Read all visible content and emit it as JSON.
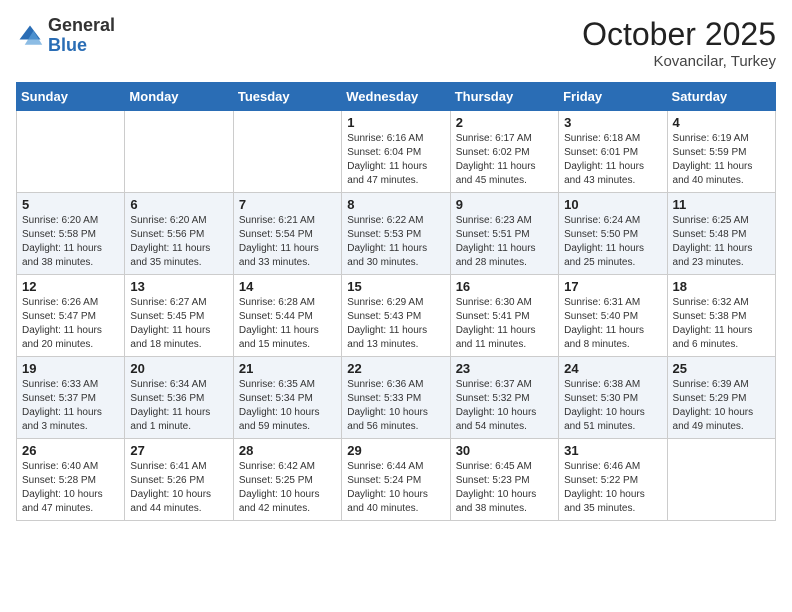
{
  "header": {
    "logo_general": "General",
    "logo_blue": "Blue",
    "month_title": "October 2025",
    "subtitle": "Kovancilar, Turkey"
  },
  "days_of_week": [
    "Sunday",
    "Monday",
    "Tuesday",
    "Wednesday",
    "Thursday",
    "Friday",
    "Saturday"
  ],
  "weeks": [
    [
      {
        "day": "",
        "info": ""
      },
      {
        "day": "",
        "info": ""
      },
      {
        "day": "",
        "info": ""
      },
      {
        "day": "1",
        "info": "Sunrise: 6:16 AM\nSunset: 6:04 PM\nDaylight: 11 hours and 47 minutes."
      },
      {
        "day": "2",
        "info": "Sunrise: 6:17 AM\nSunset: 6:02 PM\nDaylight: 11 hours and 45 minutes."
      },
      {
        "day": "3",
        "info": "Sunrise: 6:18 AM\nSunset: 6:01 PM\nDaylight: 11 hours and 43 minutes."
      },
      {
        "day": "4",
        "info": "Sunrise: 6:19 AM\nSunset: 5:59 PM\nDaylight: 11 hours and 40 minutes."
      }
    ],
    [
      {
        "day": "5",
        "info": "Sunrise: 6:20 AM\nSunset: 5:58 PM\nDaylight: 11 hours and 38 minutes."
      },
      {
        "day": "6",
        "info": "Sunrise: 6:20 AM\nSunset: 5:56 PM\nDaylight: 11 hours and 35 minutes."
      },
      {
        "day": "7",
        "info": "Sunrise: 6:21 AM\nSunset: 5:54 PM\nDaylight: 11 hours and 33 minutes."
      },
      {
        "day": "8",
        "info": "Sunrise: 6:22 AM\nSunset: 5:53 PM\nDaylight: 11 hours and 30 minutes."
      },
      {
        "day": "9",
        "info": "Sunrise: 6:23 AM\nSunset: 5:51 PM\nDaylight: 11 hours and 28 minutes."
      },
      {
        "day": "10",
        "info": "Sunrise: 6:24 AM\nSunset: 5:50 PM\nDaylight: 11 hours and 25 minutes."
      },
      {
        "day": "11",
        "info": "Sunrise: 6:25 AM\nSunset: 5:48 PM\nDaylight: 11 hours and 23 minutes."
      }
    ],
    [
      {
        "day": "12",
        "info": "Sunrise: 6:26 AM\nSunset: 5:47 PM\nDaylight: 11 hours and 20 minutes."
      },
      {
        "day": "13",
        "info": "Sunrise: 6:27 AM\nSunset: 5:45 PM\nDaylight: 11 hours and 18 minutes."
      },
      {
        "day": "14",
        "info": "Sunrise: 6:28 AM\nSunset: 5:44 PM\nDaylight: 11 hours and 15 minutes."
      },
      {
        "day": "15",
        "info": "Sunrise: 6:29 AM\nSunset: 5:43 PM\nDaylight: 11 hours and 13 minutes."
      },
      {
        "day": "16",
        "info": "Sunrise: 6:30 AM\nSunset: 5:41 PM\nDaylight: 11 hours and 11 minutes."
      },
      {
        "day": "17",
        "info": "Sunrise: 6:31 AM\nSunset: 5:40 PM\nDaylight: 11 hours and 8 minutes."
      },
      {
        "day": "18",
        "info": "Sunrise: 6:32 AM\nSunset: 5:38 PM\nDaylight: 11 hours and 6 minutes."
      }
    ],
    [
      {
        "day": "19",
        "info": "Sunrise: 6:33 AM\nSunset: 5:37 PM\nDaylight: 11 hours and 3 minutes."
      },
      {
        "day": "20",
        "info": "Sunrise: 6:34 AM\nSunset: 5:36 PM\nDaylight: 11 hours and 1 minute."
      },
      {
        "day": "21",
        "info": "Sunrise: 6:35 AM\nSunset: 5:34 PM\nDaylight: 10 hours and 59 minutes."
      },
      {
        "day": "22",
        "info": "Sunrise: 6:36 AM\nSunset: 5:33 PM\nDaylight: 10 hours and 56 minutes."
      },
      {
        "day": "23",
        "info": "Sunrise: 6:37 AM\nSunset: 5:32 PM\nDaylight: 10 hours and 54 minutes."
      },
      {
        "day": "24",
        "info": "Sunrise: 6:38 AM\nSunset: 5:30 PM\nDaylight: 10 hours and 51 minutes."
      },
      {
        "day": "25",
        "info": "Sunrise: 6:39 AM\nSunset: 5:29 PM\nDaylight: 10 hours and 49 minutes."
      }
    ],
    [
      {
        "day": "26",
        "info": "Sunrise: 6:40 AM\nSunset: 5:28 PM\nDaylight: 10 hours and 47 minutes."
      },
      {
        "day": "27",
        "info": "Sunrise: 6:41 AM\nSunset: 5:26 PM\nDaylight: 10 hours and 44 minutes."
      },
      {
        "day": "28",
        "info": "Sunrise: 6:42 AM\nSunset: 5:25 PM\nDaylight: 10 hours and 42 minutes."
      },
      {
        "day": "29",
        "info": "Sunrise: 6:44 AM\nSunset: 5:24 PM\nDaylight: 10 hours and 40 minutes."
      },
      {
        "day": "30",
        "info": "Sunrise: 6:45 AM\nSunset: 5:23 PM\nDaylight: 10 hours and 38 minutes."
      },
      {
        "day": "31",
        "info": "Sunrise: 6:46 AM\nSunset: 5:22 PM\nDaylight: 10 hours and 35 minutes."
      },
      {
        "day": "",
        "info": ""
      }
    ]
  ]
}
